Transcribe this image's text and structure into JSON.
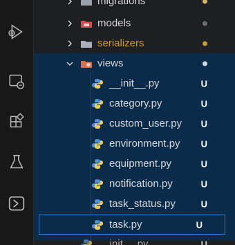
{
  "activity_bar": {
    "icons": [
      {
        "name": "run-debug-icon"
      },
      {
        "name": "remote-explorer-icon"
      },
      {
        "name": "extensions-icon"
      },
      {
        "name": "testing-icon"
      },
      {
        "name": "terminal-icon"
      }
    ]
  },
  "tree": {
    "rows": [
      {
        "kind": "folder",
        "label": "migrations",
        "expanded": false,
        "indicator": "dot",
        "indicator_color": "#d3b35a"
      },
      {
        "kind": "folder",
        "label": "models",
        "expanded": false,
        "indicator": "dot",
        "indicator_color": "#6c6c6c",
        "folder_color": "#d14d4d"
      },
      {
        "kind": "folder",
        "label": "serializers",
        "expanded": false,
        "indicator": "dot",
        "indicator_color": "#c29b2f",
        "label_color": "#d39b2b"
      },
      {
        "kind": "folder",
        "label": "views",
        "expanded": true,
        "indicator": "dot",
        "indicator_color": "#cfd3da",
        "folder_color": "#d96f4b"
      },
      {
        "kind": "file",
        "label": "__init__.py",
        "status": "U"
      },
      {
        "kind": "file",
        "label": "category.py",
        "status": "U"
      },
      {
        "kind": "file",
        "label": "custom_user.py",
        "status": "U"
      },
      {
        "kind": "file",
        "label": "environment.py",
        "status": "U"
      },
      {
        "kind": "file",
        "label": "equipment.py",
        "status": "U"
      },
      {
        "kind": "file",
        "label": "notification.py",
        "status": "U"
      },
      {
        "kind": "file",
        "label": "task_status.py",
        "status": "U"
      },
      {
        "kind": "file",
        "label": "task.py",
        "status": "U",
        "focused": true
      },
      {
        "kind": "file",
        "label": "__init__.py",
        "status": "U",
        "dimmed": true
      }
    ]
  },
  "colors": {
    "accent": "#2f7fd6",
    "selection_bg": "#0b2b4a",
    "explorer_bg": "#1e1f22",
    "activity_bg": "#181818"
  }
}
